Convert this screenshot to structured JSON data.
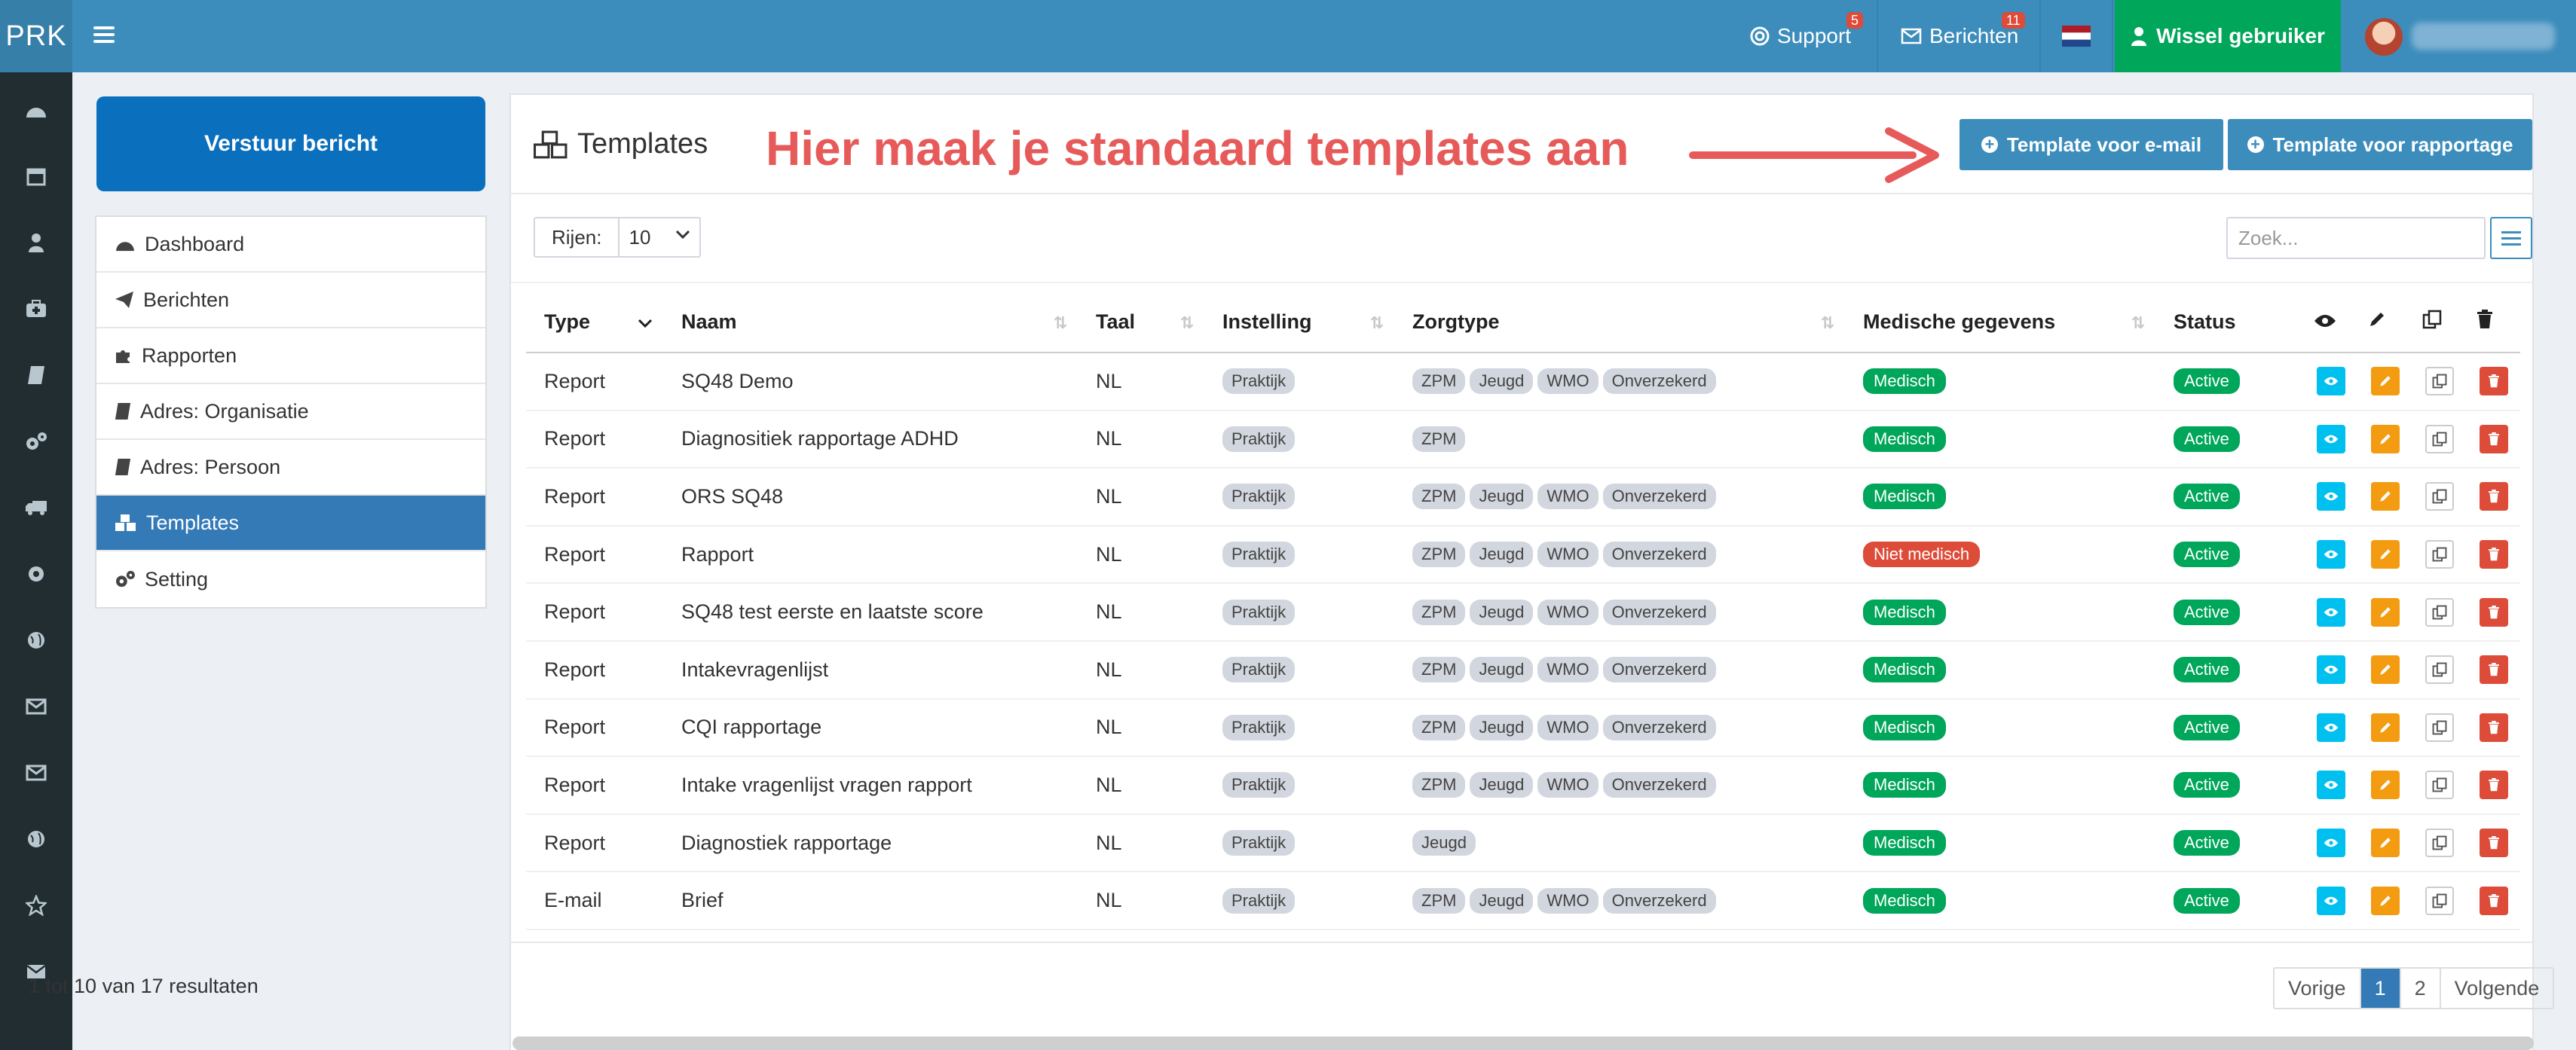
{
  "app": {
    "logo": "PRK",
    "support_label": "Support",
    "support_count": "5",
    "messages_label": "Berichten",
    "messages_count": "11",
    "switch_user_label": "Wissel gebruiker",
    "language_flag": "nl-flag-icon"
  },
  "sidebar": {
    "send_button": "Verstuur bericht",
    "items": [
      {
        "label": "Dashboard",
        "icon": "dashboard-icon"
      },
      {
        "label": "Berichten",
        "icon": "paper-plane-icon"
      },
      {
        "label": "Rapporten",
        "icon": "puzzle-icon"
      },
      {
        "label": "Adres: Organisatie",
        "icon": "book-icon"
      },
      {
        "label": "Adres: Persoon",
        "icon": "book-icon"
      },
      {
        "label": "Templates",
        "icon": "cubes-icon",
        "active": true
      },
      {
        "label": "Setting",
        "icon": "cogs-icon"
      }
    ]
  },
  "main": {
    "title": "Templates",
    "annotation": "Hier maak je standaard templates aan",
    "btn_email": "Template voor e-mail",
    "btn_report": "Template voor rapportage",
    "rows_label": "Rijen:",
    "rows_value": "10",
    "search_placeholder": "Zoek...",
    "columns": {
      "type": "Type",
      "naam": "Naam",
      "taal": "Taal",
      "instelling": "Instelling",
      "zorgtype": "Zorgtype",
      "medisch": "Medische gegevens",
      "status": "Status"
    },
    "rows": [
      {
        "type": "Report",
        "naam": "SQ48 Demo",
        "taal": "NL",
        "instelling": "Praktijk",
        "zorg": [
          "ZPM",
          "Jeugd",
          "WMO",
          "Onverzekerd"
        ],
        "medisch": "Medisch",
        "medisch_color": "green",
        "status": "Active"
      },
      {
        "type": "Report",
        "naam": "Diagnositiek rapportage ADHD",
        "taal": "NL",
        "instelling": "Praktijk",
        "zorg": [
          "ZPM"
        ],
        "medisch": "Medisch",
        "medisch_color": "green",
        "status": "Active"
      },
      {
        "type": "Report",
        "naam": "ORS SQ48",
        "taal": "NL",
        "instelling": "Praktijk",
        "zorg": [
          "ZPM",
          "Jeugd",
          "WMO",
          "Onverzekerd"
        ],
        "medisch": "Medisch",
        "medisch_color": "green",
        "status": "Active"
      },
      {
        "type": "Report",
        "naam": "Rapport",
        "taal": "NL",
        "instelling": "Praktijk",
        "zorg": [
          "ZPM",
          "Jeugd",
          "WMO",
          "Onverzekerd"
        ],
        "medisch": "Niet medisch",
        "medisch_color": "red",
        "status": "Active"
      },
      {
        "type": "Report",
        "naam": "SQ48 test eerste en laatste score",
        "taal": "NL",
        "instelling": "Praktijk",
        "zorg": [
          "ZPM",
          "Jeugd",
          "WMO",
          "Onverzekerd"
        ],
        "medisch": "Medisch",
        "medisch_color": "green",
        "status": "Active"
      },
      {
        "type": "Report",
        "naam": "Intakevragenlijst",
        "taal": "NL",
        "instelling": "Praktijk",
        "zorg": [
          "ZPM",
          "Jeugd",
          "WMO",
          "Onverzekerd"
        ],
        "medisch": "Medisch",
        "medisch_color": "green",
        "status": "Active"
      },
      {
        "type": "Report",
        "naam": "CQI rapportage",
        "taal": "NL",
        "instelling": "Praktijk",
        "zorg": [
          "ZPM",
          "Jeugd",
          "WMO",
          "Onverzekerd"
        ],
        "medisch": "Medisch",
        "medisch_color": "green",
        "status": "Active"
      },
      {
        "type": "Report",
        "naam": "Intake vragenlijst vragen rapport",
        "taal": "NL",
        "instelling": "Praktijk",
        "zorg": [
          "ZPM",
          "Jeugd",
          "WMO",
          "Onverzekerd"
        ],
        "medisch": "Medisch",
        "medisch_color": "green",
        "status": "Active"
      },
      {
        "type": "Report",
        "naam": "Diagnostiek rapportage",
        "taal": "NL",
        "instelling": "Praktijk",
        "zorg": [
          "Jeugd"
        ],
        "medisch": "Medisch",
        "medisch_color": "green",
        "status": "Active"
      },
      {
        "type": "E-mail",
        "naam": "Brief",
        "taal": "NL",
        "instelling": "Praktijk",
        "zorg": [
          "ZPM",
          "Jeugd",
          "WMO",
          "Onverzekerd"
        ],
        "medisch": "Medisch",
        "medisch_color": "green",
        "status": "Active"
      }
    ],
    "results_text": "1 tot 10 van 17 resultaten",
    "pager": {
      "prev": "Vorige",
      "pages": [
        "1",
        "2"
      ],
      "current": "1",
      "next": "Volgende"
    }
  },
  "colors": {
    "topbar": "#3c8dbc",
    "sidebar_dark": "#222d32",
    "accent": "#337ab7",
    "success": "#00a65a",
    "danger": "#dd4b39",
    "annotation": "#e75a5a"
  }
}
